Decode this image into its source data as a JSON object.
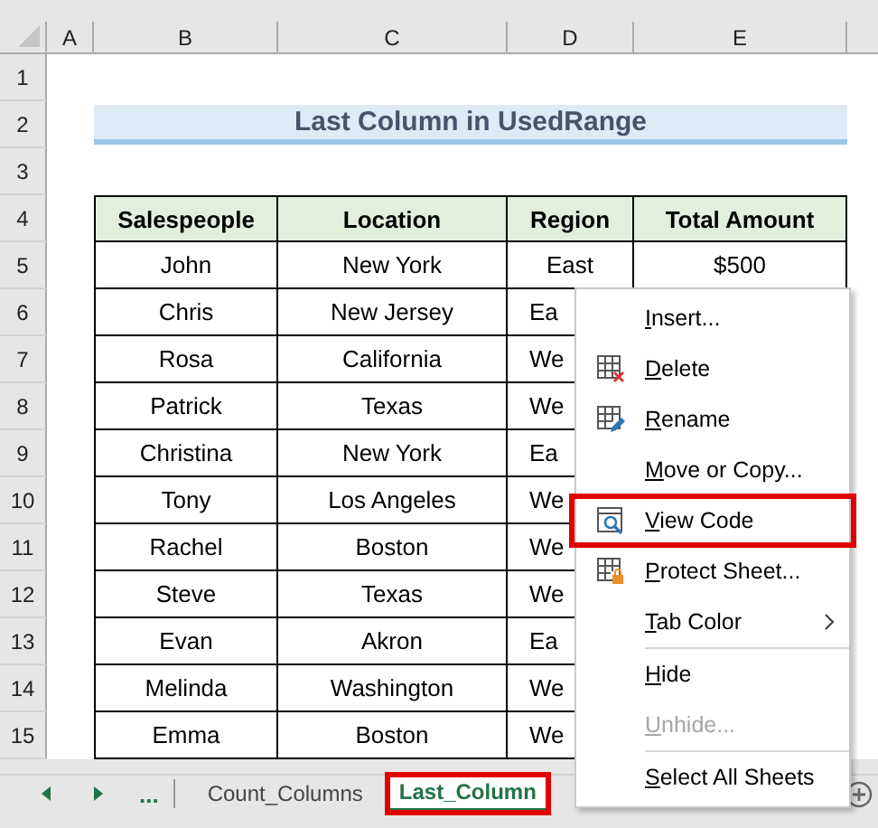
{
  "columns": [
    "A",
    "B",
    "C",
    "D",
    "E"
  ],
  "rows": [
    "1",
    "2",
    "3",
    "4",
    "5",
    "6",
    "7",
    "8",
    "9",
    "10",
    "11",
    "12",
    "13",
    "14",
    "15"
  ],
  "title": "Last Column in UsedRange",
  "table": {
    "headers": [
      "Salespeople",
      "Location",
      "Region",
      "Total Amount"
    ],
    "rows": [
      [
        "John",
        "New York",
        "East",
        "$500"
      ],
      [
        "Chris",
        "New Jersey",
        "Ea"
      ],
      [
        "Rosa",
        "California",
        "We"
      ],
      [
        "Patrick",
        "Texas",
        "We"
      ],
      [
        "Christina",
        "New York",
        "Ea"
      ],
      [
        "Tony",
        "Los Angeles",
        "We"
      ],
      [
        "Rachel",
        "Boston",
        "We"
      ],
      [
        "Steve",
        "Texas",
        "We"
      ],
      [
        "Evan",
        "Akron",
        "Ea"
      ],
      [
        "Melinda",
        "Washington",
        "We"
      ],
      [
        "Emma",
        "Boston",
        "We"
      ]
    ]
  },
  "context_menu": [
    {
      "label": "Insert...",
      "kind": "plain",
      "disabled": false,
      "highlighted": false
    },
    {
      "label": "Delete",
      "kind": "delete",
      "disabled": false,
      "highlighted": false
    },
    {
      "label": "Rename",
      "kind": "rename",
      "disabled": false,
      "highlighted": false
    },
    {
      "label": "Move or Copy...",
      "kind": "plain",
      "disabled": false,
      "highlighted": false
    },
    {
      "label": "View Code",
      "kind": "code",
      "disabled": false,
      "highlighted": true
    },
    {
      "label": "Protect Sheet...",
      "kind": "protect",
      "disabled": false,
      "highlighted": false
    },
    {
      "label": "Tab Color",
      "kind": "plain",
      "submenu": true,
      "disabled": false,
      "highlighted": false,
      "separator_after": true
    },
    {
      "label": "Hide",
      "kind": "plain",
      "disabled": false,
      "highlighted": false
    },
    {
      "label": "Unhide...",
      "kind": "plain",
      "disabled": true,
      "highlighted": false,
      "separator_after": true
    },
    {
      "label": "Select All Sheets",
      "kind": "plain",
      "disabled": false,
      "highlighted": false
    }
  ],
  "sheet_tabs": {
    "more": "...",
    "tabs": [
      {
        "label": "Count_Columns",
        "selected": false,
        "highlighted": false
      },
      {
        "label": "Last_Column",
        "selected": true,
        "highlighted": true
      }
    ]
  }
}
